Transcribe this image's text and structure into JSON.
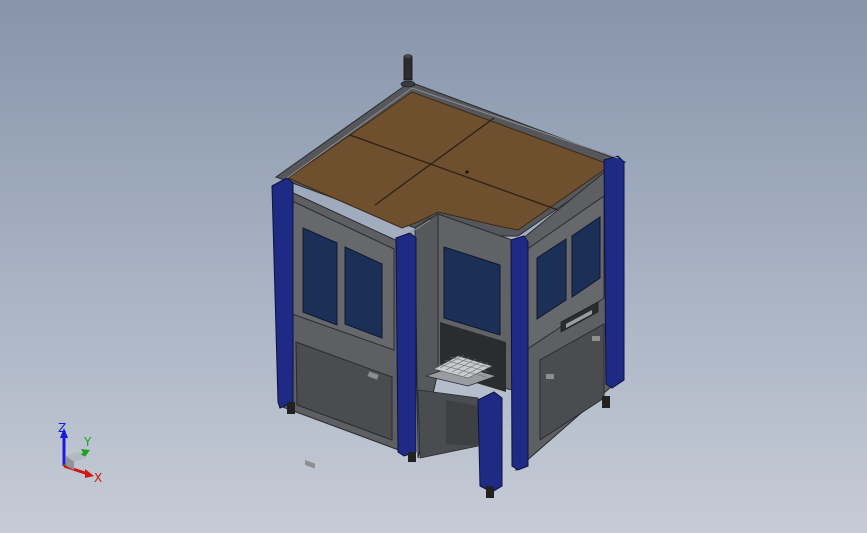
{
  "viewport": {
    "background_top": "#8794aa",
    "background_bottom": "#c6ccd6"
  },
  "model": {
    "colors": {
      "top_panel": "#6e4f2e",
      "frame_light": "#6b6d70",
      "frame_dark": "#3c3e42",
      "frame_edge": "#8a8d92",
      "post_blue": "#1f2a84",
      "window_blue": "#1c2f57",
      "door_panel": "#4a4c50",
      "grid_tray": "#c8cacd"
    }
  },
  "triad": {
    "z_label": "Z",
    "y_label": "Y",
    "x_label": "X",
    "colors": {
      "z": "#1a1adc",
      "y": "#1da51d",
      "x": "#d51414"
    }
  }
}
